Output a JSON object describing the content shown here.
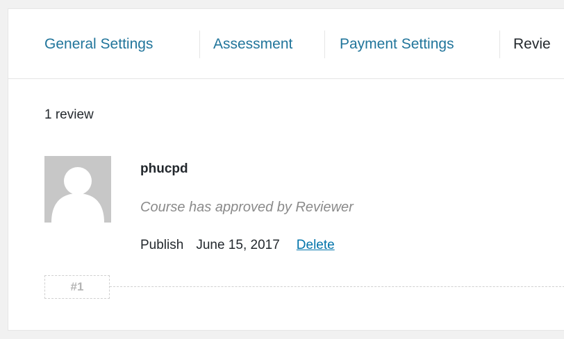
{
  "tabs": [
    {
      "label": "General Settings",
      "active": false
    },
    {
      "label": "Assessment",
      "active": false
    },
    {
      "label": "Payment Settings",
      "active": false
    },
    {
      "label": "Revie",
      "active": true
    }
  ],
  "reviews": {
    "count_label": "1 review",
    "items": [
      {
        "author": "phucpd",
        "comment": "Course has approved by Reviewer",
        "status": "Publish",
        "date": "June 15, 2017",
        "delete_label": "Delete",
        "number": "#1",
        "avatar_icon": "default-avatar-icon"
      }
    ]
  },
  "colors": {
    "link": "#21759b",
    "text": "#23282d",
    "muted": "#8a8a8a",
    "avatar_bg": "#c7c7c7"
  }
}
